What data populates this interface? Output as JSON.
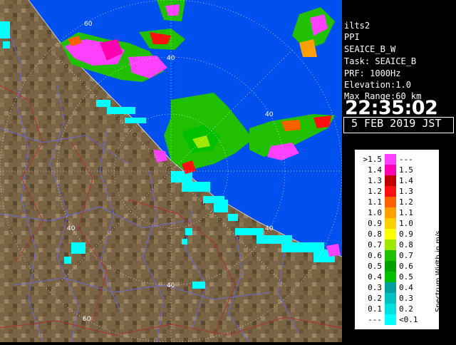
{
  "info": {
    "lines": [
      "ilts2",
      "PPI",
      "SEAICE_B_W",
      "Task: SEAICE_B",
      "PRF: 1000Hz",
      "Elevation:1.0",
      "Max Range:60 km"
    ],
    "time": "22:35:02",
    "date": "5 FEB 2019 JST"
  },
  "legend": {
    "title": "Spectrum Width in m/s",
    "rows": [
      {
        "label": ">1.5",
        "range": "---",
        "color": "#ff40ff"
      },
      {
        "label": "1.4",
        "range": "1.5",
        "color": "#ff00b0"
      },
      {
        "label": "1.3",
        "range": "1.4",
        "color": "#c00000"
      },
      {
        "label": "1.2",
        "range": "1.3",
        "color": "#ff1010"
      },
      {
        "label": "1.1",
        "range": "1.2",
        "color": "#ff6000"
      },
      {
        "label": "1.0",
        "range": "1.1",
        "color": "#ffa000"
      },
      {
        "label": "0.9",
        "range": "1.0",
        "color": "#ffd000"
      },
      {
        "label": "0.8",
        "range": "0.9",
        "color": "#ffff00"
      },
      {
        "label": "0.7",
        "range": "0.8",
        "color": "#a0e800"
      },
      {
        "label": "0.6",
        "range": "0.7",
        "color": "#20c000"
      },
      {
        "label": "0.5",
        "range": "0.6",
        "color": "#00a000"
      },
      {
        "label": "0.4",
        "range": "0.5",
        "color": "#00c000"
      },
      {
        "label": "0.3",
        "range": "0.4",
        "color": "#00a0a0"
      },
      {
        "label": "0.2",
        "range": "0.3",
        "color": "#00c0c0"
      },
      {
        "label": "0.1",
        "range": "0.2",
        "color": "#00e0e0"
      },
      {
        "label": "---",
        "range": "<0.1",
        "color": "#00ffff"
      }
    ]
  },
  "map": {
    "range_labels": [
      "60",
      "40",
      "40",
      "40",
      "40",
      "40",
      "60"
    ],
    "sea_color": "#0050f0",
    "land_color": "#806a48"
  }
}
